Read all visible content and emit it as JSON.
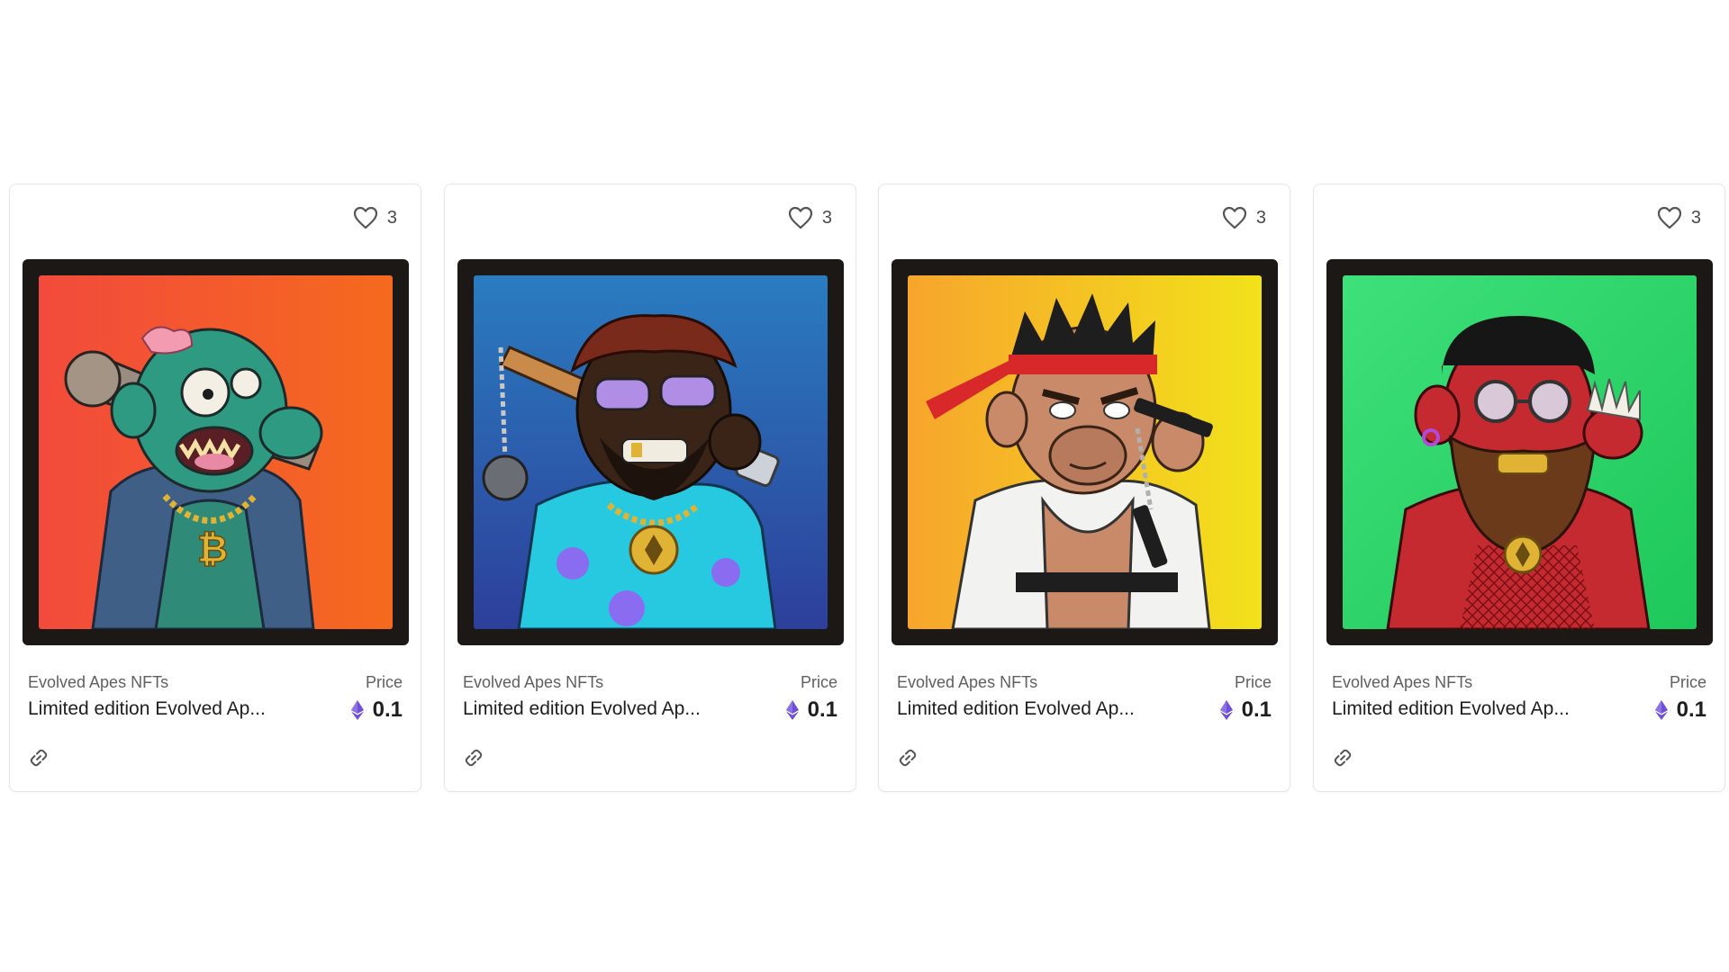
{
  "colors": {
    "card_border": "#e6e6e6",
    "text_primary": "#1e1e1e",
    "text_secondary": "#5f5f5f",
    "eth_purple": "#6f4fd8"
  },
  "cards": [
    {
      "likes": "3",
      "collection": "Evolved Apes NFTs",
      "title": "Limited edition Evolved Ap...",
      "price_label": "Price",
      "price": "0.1",
      "artwork": "green zombie ape with brain, spiked club and bitcoin chain"
    },
    {
      "likes": "3",
      "collection": "Evolved Apes NFTs",
      "title": "Limited edition Evolved Ap...",
      "price_label": "Price",
      "price": "0.1",
      "artwork": "dark ape with purple shades, floral shirt, flail and ethereum chain"
    },
    {
      "likes": "3",
      "collection": "Evolved Apes NFTs",
      "title": "Limited edition Evolved Ap...",
      "price_label": "Price",
      "price": "0.1",
      "artwork": "ape with red headband, torn gi and nunchaku"
    },
    {
      "likes": "3",
      "collection": "Evolved Apes NFTs",
      "title": "Limited edition Evolved Ap...",
      "price_label": "Price",
      "price": "0.1",
      "artwork": "red bearded ape with round glasses, fishnet shirt and spiked knuckles"
    }
  ]
}
